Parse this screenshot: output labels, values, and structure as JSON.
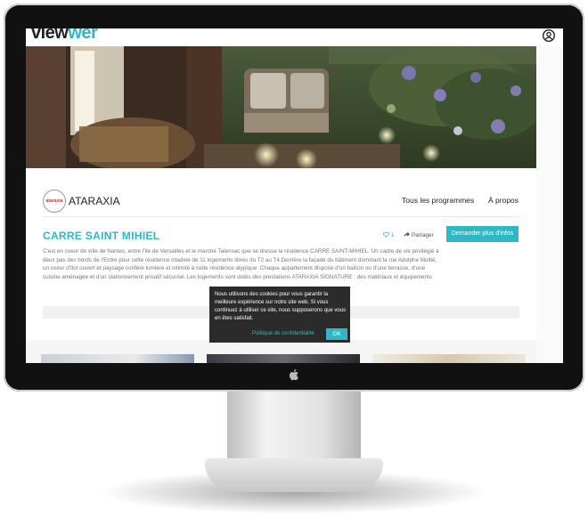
{
  "site": {
    "logo_prefix": "view",
    "logo_accent": "wer"
  },
  "brand": {
    "logo_text": "ataraxia",
    "name": "ATARAXIA"
  },
  "nav": {
    "programmes": "Tous les programmes",
    "about": "À propos"
  },
  "program": {
    "title": "CARRE SAINT MIHIEL",
    "likes": "1",
    "share_label": "Partager",
    "cta_label": "Demander plus d'infos",
    "description": "C'est en coeur de ville de Nantes, entre l'île de Versailles et le marché Talensac que se dresse la résidence CARRE SAINT-MIHIEL. Un cadre de vie privilégié à deux pas des bords de l'Erdre pour cette résidence citadine de 11 logements libres du T2 au T4.Derrière la façade du bâtiment dominant la rue Adolphe Moitié, un coeur d'îlot ouvert et paysagé confère lumière et intimité à cette résidence atypique. Chaque appartement dispose d'un balcon ou d'une terrasse, d'une cuisine aménagée et d'un stationnement privatif sécurisé. Les logements sont dotés des prestations ATARAXIA SIGNATURE : des matériaux et équipements"
  },
  "cookie": {
    "message": "Nous utilisons des cookies pour vous garantir la meilleure expérience sur notre site web. Si vous continuez à utiliser ce site, nous supposerons que vous en êtes satisfait.",
    "policy_link": "Politique de confidentialité",
    "ok_label": "OK"
  },
  "colors": {
    "accent": "#2fb8c4",
    "cookie_bg": "#2b2b2b"
  }
}
